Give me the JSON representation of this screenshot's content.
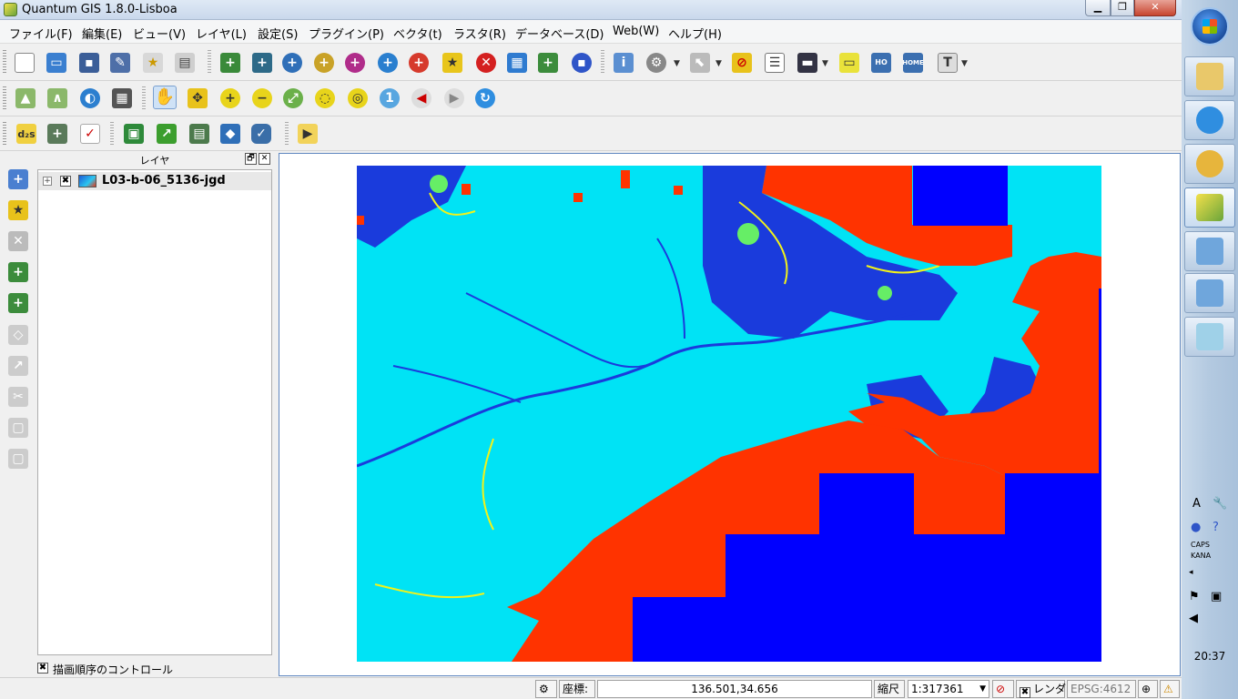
{
  "window": {
    "title": "Quantum GIS 1.8.0-Lisboa",
    "minimize": "▁",
    "maximize": "❐",
    "close": "✕"
  },
  "menu": [
    "ファイル(F)",
    "編集(E)",
    "ビュー(V)",
    "レイヤ(L)",
    "設定(S)",
    "プラグイン(P)",
    "ベクタ(t)",
    "ラスタ(R)",
    "データベース(D)",
    "Web(W)",
    "ヘルプ(H)"
  ],
  "toolbar_icons": {
    "file": [
      "new-project-icon",
      "open-project-icon",
      "save-project-icon",
      "save-as-icon",
      "print-composer-icon",
      "print-icon"
    ],
    "layer": [
      "add-vector-layer-icon",
      "add-raster-layer-icon",
      "add-postgis-layer-icon",
      "add-spatialite-layer-icon",
      "add-mssql-layer-icon",
      "add-wms-layer-icon",
      "add-wcs-layer-icon",
      "add-wfs-layer-icon",
      "remove-layer-icon",
      "new-shapefile-icon",
      "add-delimited-text-icon",
      "oracle-georaster-icon"
    ],
    "attributes": [
      "identify-icon",
      "action-icon",
      "select-icon",
      "deselect-icon",
      "attribute-table-icon",
      "measure-icon",
      "annotation-icon",
      "set-home-icon",
      "home-icon",
      "text-annotation-icon"
    ],
    "nav": [
      "raster-histogram-icon",
      "raster-stretch-icon",
      "globe-icon",
      "pixel-info-icon",
      "pan-icon",
      "pan-to-selection-icon",
      "zoom-in-icon",
      "zoom-out-icon",
      "zoom-full-icon",
      "zoom-selection-icon",
      "zoom-layer-icon",
      "zoom-actual-icon",
      "zoom-last-icon",
      "zoom-next-icon",
      "refresh-icon"
    ],
    "plugins": [
      "d2s-icon",
      "plugin-add-icon",
      "georeferencer-icon",
      "grass-open-icon",
      "grass-tools-icon",
      "grass-mapset-icon",
      "grass-region-icon",
      "database-icon",
      "python-console-icon"
    ],
    "digitize": [
      "add-vector-icon",
      "new-layer-icon",
      "remove-icon",
      "add-feature-icon",
      "edit-icon",
      "node-tool-icon",
      "move-icon",
      "split-icon",
      "merge-icon",
      "reshape-icon"
    ]
  },
  "layers_panel": {
    "title": "レイヤ",
    "float_btn": "🗗",
    "close_btn": "✕",
    "expand": "+",
    "check": "✖",
    "layers": [
      {
        "name": "L03-b-06_5136-jgd",
        "visible": true
      }
    ],
    "draw_order_check": "✖",
    "draw_order_label": "描画順序のコントロール"
  },
  "colors": {
    "water": "#00e3f5",
    "forest": "#1a3bdc",
    "urban": "#ff3300",
    "farmland": "#f2f219",
    "field": "#66ee66",
    "nodata": "#0000ff"
  },
  "status": {
    "coord_label": "座標:",
    "coord_value": "136.501,34.656",
    "scale_label": "縮尺",
    "scale_value": "1:317361",
    "render_label": "レンダ",
    "render_check": "✖",
    "epsg": "EPSG:4612"
  },
  "taskbar": {
    "clock": "20:37",
    "caps": "CAPS",
    "kana": "KANA"
  }
}
